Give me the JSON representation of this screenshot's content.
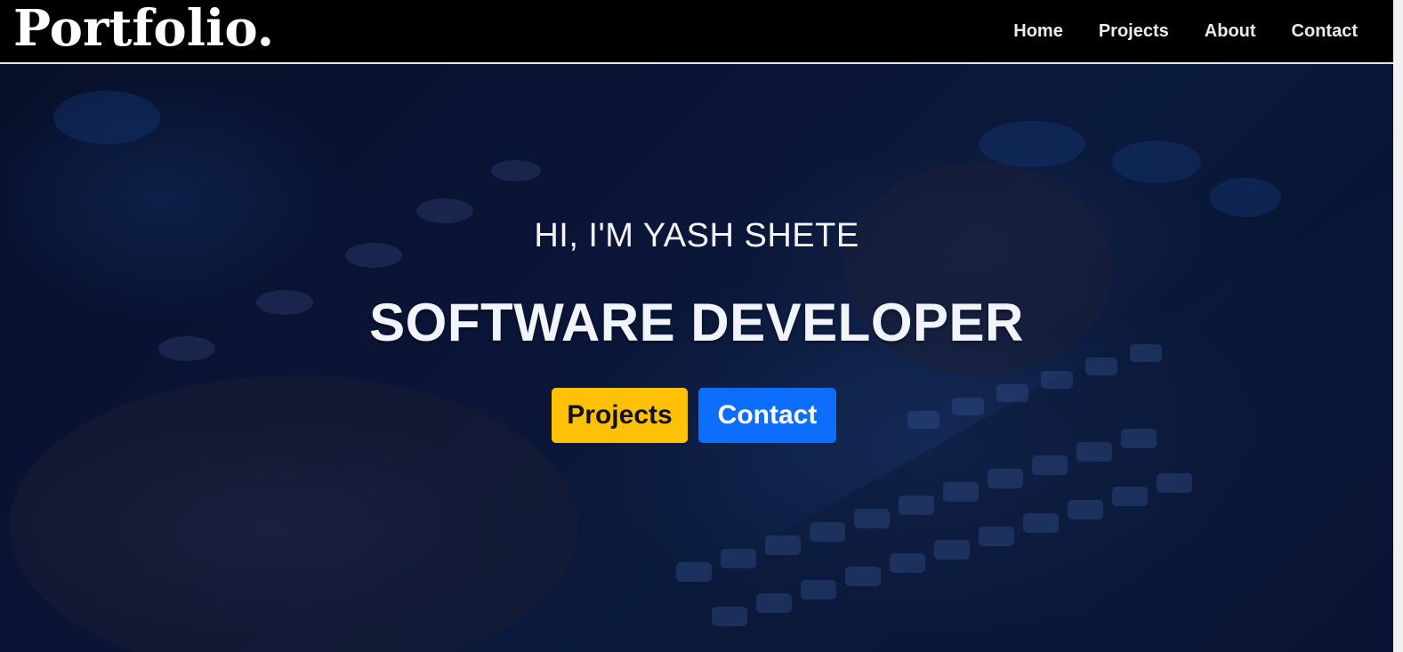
{
  "navbar": {
    "brand": "Portfolio.",
    "links": [
      {
        "label": "Home"
      },
      {
        "label": "Projects"
      },
      {
        "label": "About"
      },
      {
        "label": "Contact"
      }
    ]
  },
  "hero": {
    "greeting": "HI, I'M YASH SHETE",
    "role": "SOFTWARE DEVELOPER",
    "buttons": {
      "projects_label": "Projects",
      "contact_label": "Contact"
    },
    "background_image": "blurred-hands-typing-on-backlit-laptop-keyboard"
  },
  "colors": {
    "nav_background": "#000000",
    "hero_overlay": "#0b1436",
    "projects_button": "#ffc107",
    "contact_button": "#0d6efd",
    "text": "#f2f4f8"
  }
}
